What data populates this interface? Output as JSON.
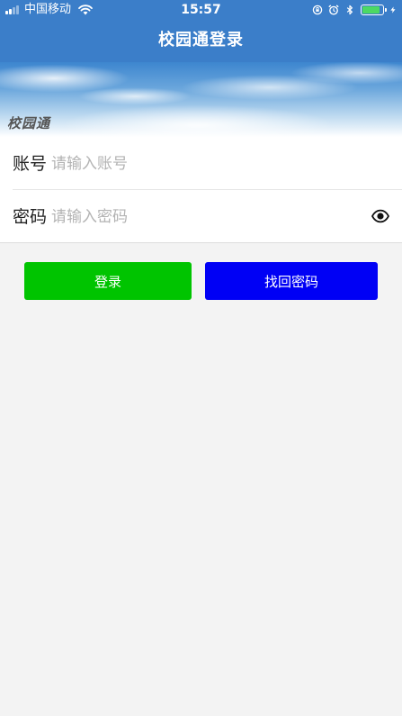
{
  "status_bar": {
    "carrier": "中国移动",
    "time": "15:57",
    "battery_level": 0.85,
    "icons": [
      "signal-icon",
      "wifi-icon",
      "orientation-lock-icon",
      "alarm-icon",
      "bluetooth-icon",
      "battery-icon",
      "charging-icon"
    ]
  },
  "nav": {
    "title": "校园通登录"
  },
  "banner": {
    "logo_text": "校园通"
  },
  "form": {
    "account": {
      "label": "账号",
      "placeholder": "请输入账号",
      "value": ""
    },
    "password": {
      "label": "密码",
      "placeholder": "请输入密码",
      "value": "",
      "toggle_icon": "eye-icon"
    }
  },
  "buttons": {
    "login_label": "登录",
    "recover_label": "找回密码"
  },
  "colors": {
    "nav_background": "#3b7ec9",
    "login_button": "#00c400",
    "recover_button": "#0000f5",
    "page_background": "#f3f3f3",
    "battery_fill": "#4cd964"
  }
}
